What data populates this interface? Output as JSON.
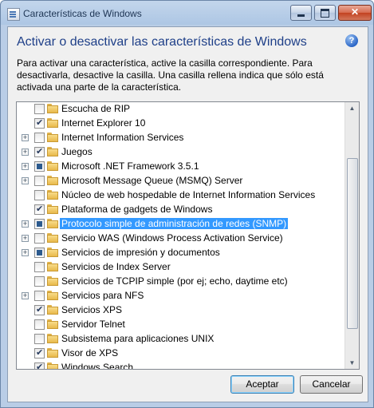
{
  "window": {
    "title": "Características de Windows",
    "heading": "Activar o desactivar las características de Windows",
    "help_glyph": "?",
    "description": "Para activar una característica, active la casilla correspondiente. Para desactivarla, desactive la casilla. Una casilla rellena indica que sólo está activada una parte de la característica."
  },
  "features": [
    {
      "label": "Escucha de RIP",
      "state": "unchecked",
      "expandable": false
    },
    {
      "label": "Internet Explorer 10",
      "state": "checked",
      "expandable": false
    },
    {
      "label": "Internet Information Services",
      "state": "unchecked",
      "expandable": true
    },
    {
      "label": "Juegos",
      "state": "checked",
      "expandable": true
    },
    {
      "label": "Microsoft .NET Framework 3.5.1",
      "state": "partial",
      "expandable": true
    },
    {
      "label": "Microsoft Message Queue (MSMQ) Server",
      "state": "unchecked",
      "expandable": true
    },
    {
      "label": "Núcleo de web hospedable de Internet Information Services",
      "state": "unchecked",
      "expandable": false
    },
    {
      "label": "Plataforma de gadgets de Windows",
      "state": "checked",
      "expandable": false
    },
    {
      "label": "Protocolo simple de administración de redes (SNMP)",
      "state": "partial",
      "expandable": true,
      "selected": true
    },
    {
      "label": "Servicio WAS (Windows Process Activation Service)",
      "state": "unchecked",
      "expandable": true
    },
    {
      "label": "Servicios de impresión y documentos",
      "state": "partial",
      "expandable": true
    },
    {
      "label": "Servicios de Index Server",
      "state": "unchecked",
      "expandable": false
    },
    {
      "label": "Servicios de TCPIP simple (por ej; echo, daytime etc)",
      "state": "unchecked",
      "expandable": false
    },
    {
      "label": "Servicios para NFS",
      "state": "unchecked",
      "expandable": true
    },
    {
      "label": "Servicios XPS",
      "state": "checked",
      "expandable": false
    },
    {
      "label": "Servidor Telnet",
      "state": "unchecked",
      "expandable": false
    },
    {
      "label": "Subsistema para aplicaciones UNIX",
      "state": "unchecked",
      "expandable": false
    },
    {
      "label": "Visor de XPS",
      "state": "checked",
      "expandable": false
    },
    {
      "label": "Windows Search",
      "state": "checked",
      "expandable": false
    }
  ],
  "buttons": {
    "ok": "Aceptar",
    "cancel": "Cancelar"
  }
}
